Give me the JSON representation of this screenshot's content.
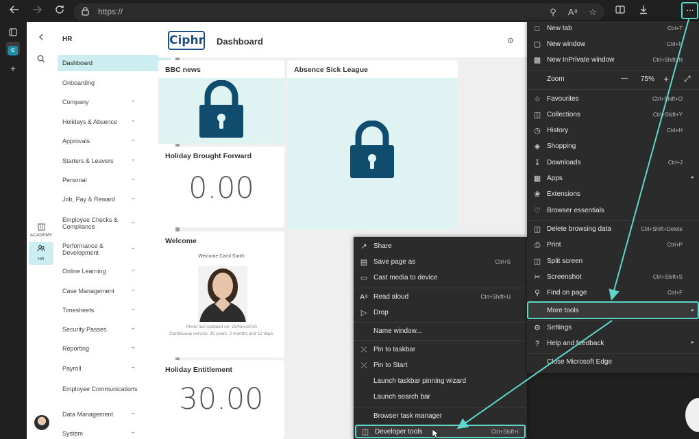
{
  "browser": {
    "url": "https://",
    "more_label": "···"
  },
  "rail": {
    "academy_label": "ACADEMY",
    "hr_label": "HR"
  },
  "nav": {
    "title": "HR",
    "items": [
      {
        "label": "Dashboard",
        "chevron": false
      },
      {
        "label": "Onboarding",
        "chevron": false
      },
      {
        "label": "Company",
        "chevron": true
      },
      {
        "label": "Holidays & Absence",
        "chevron": true
      },
      {
        "label": "Approvals",
        "chevron": true
      },
      {
        "label": "Starters & Leavers",
        "chevron": true
      },
      {
        "label": "Personal",
        "chevron": true
      },
      {
        "label": "Job, Pay & Reward",
        "chevron": true
      },
      {
        "label": "Employee Checks & Compliance",
        "chevron": true
      },
      {
        "label": "Performance & Development",
        "chevron": true
      },
      {
        "label": "Online Learning",
        "chevron": true
      },
      {
        "label": "Case Management",
        "chevron": true
      },
      {
        "label": "Timesheets",
        "chevron": true
      },
      {
        "label": "Security Passes",
        "chevron": true
      },
      {
        "label": "Reporting",
        "chevron": true
      },
      {
        "label": "Payroll",
        "chevron": true
      },
      {
        "label": "Employee Communications",
        "chevron": true
      },
      {
        "label": "Data Management",
        "chevron": true
      },
      {
        "label": "System",
        "chevron": true
      }
    ]
  },
  "header": {
    "logo": "Ciphr",
    "title": "Dashboard"
  },
  "cards": {
    "bbc": "BBC news",
    "absence": "Absence Sick League",
    "holiday_bf": {
      "title": "Holiday Brought Forward",
      "value": "0.00"
    },
    "welcome": {
      "title": "Welcome",
      "greeting": "Welcome Carol Smith",
      "photo_note": "Photo last updated on: 15/Nov/2010",
      "service": "Continuous service: 30 years, 2 months and 12 days"
    },
    "holiday_ent": {
      "title": "Holiday Entitlement",
      "value": "30.00"
    }
  },
  "menu": {
    "new_tab": {
      "label": "New tab",
      "shortcut": "Ctrl+T"
    },
    "new_window": {
      "label": "New window",
      "shortcut": "Ctrl+N"
    },
    "new_inprivate": {
      "label": "New InPrivate window",
      "shortcut": "Ctrl+Shift+N"
    },
    "zoom": {
      "label": "Zoom",
      "minus": "—",
      "value": "75%",
      "plus": "+"
    },
    "favourites": {
      "label": "Favourites",
      "shortcut": "Ctrl+Shift+O"
    },
    "collections": {
      "label": "Collections",
      "shortcut": "Ctrl+Shift+Y"
    },
    "history": {
      "label": "History",
      "shortcut": "Ctrl+H"
    },
    "shopping": {
      "label": "Shopping"
    },
    "downloads": {
      "label": "Downloads",
      "shortcut": "Ctrl+J"
    },
    "apps": {
      "label": "Apps"
    },
    "extensions": {
      "label": "Extensions"
    },
    "essentials": {
      "label": "Browser essentials"
    },
    "delete_data": {
      "label": "Delete browsing data",
      "shortcut": "Ctrl+Shift+Delete"
    },
    "print": {
      "label": "Print",
      "shortcut": "Ctrl+P"
    },
    "split": {
      "label": "Split screen"
    },
    "screenshot": {
      "label": "Screenshot",
      "shortcut": "Ctrl+Shift+S"
    },
    "find": {
      "label": "Find on page",
      "shortcut": "Ctrl+F"
    },
    "more_tools": {
      "label": "More tools"
    },
    "settings": {
      "label": "Settings"
    },
    "help": {
      "label": "Help and feedback"
    },
    "close": {
      "label": "Close Microsoft Edge"
    }
  },
  "submenu": {
    "share": {
      "label": "Share"
    },
    "save_page": {
      "label": "Save page as",
      "shortcut": "Ctrl+S"
    },
    "cast": {
      "label": "Cast media to device"
    },
    "read_aloud": {
      "label": "Read aloud",
      "shortcut": "Ctrl+Shift+U"
    },
    "drop": {
      "label": "Drop"
    },
    "name_window": {
      "label": "Name window..."
    },
    "pin_taskbar": {
      "label": "Pin to taskbar"
    },
    "pin_start": {
      "label": "Pin to Start"
    },
    "launch_wizard": {
      "label": "Launch taskbar pinning wizard"
    },
    "launch_search": {
      "label": "Launch search bar"
    },
    "task_manager": {
      "label": "Browser task manager"
    },
    "dev_tools": {
      "label": "Developer tools",
      "shortcut": "Ctrl+Shift+I"
    }
  },
  "colors": {
    "accent": "#5ed6c9",
    "lock": "#0f4c6e",
    "active_nav": "#cdeef0"
  }
}
